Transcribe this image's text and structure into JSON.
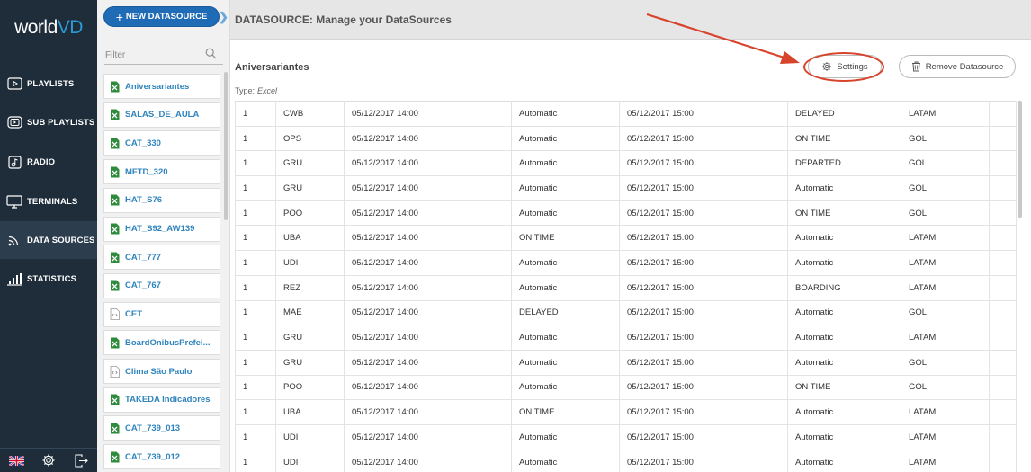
{
  "app": {
    "logo_text_1": "world",
    "logo_text_2": "VD",
    "accent_color": "#2a9ad6",
    "brand_blue": "#1f6bb5",
    "annotation_color": "#d8432b"
  },
  "nav": {
    "items": [
      {
        "label": "PLAYLISTS",
        "icon": "playlist-icon"
      },
      {
        "label": "SUB PLAYLISTS",
        "icon": "sub-playlist-icon"
      },
      {
        "label": "RADIO",
        "icon": "radio-icon"
      },
      {
        "label": "TERMINALS",
        "icon": "terminal-icon"
      },
      {
        "label": "DATA SOURCES",
        "icon": "datasource-icon"
      },
      {
        "label": "STATISTICS",
        "icon": "statistics-icon"
      }
    ],
    "active": "DATA SOURCES",
    "bottom_icons": [
      "uk-flag-icon",
      "gear-icon",
      "logout-icon"
    ]
  },
  "list": {
    "new_button": "NEW DATASOURCE",
    "filter_placeholder": "Filter",
    "items": [
      {
        "name": "Aniversariantes",
        "type": "excel"
      },
      {
        "name": "SALAS_DE_AULA",
        "type": "excel"
      },
      {
        "name": "CAT_330",
        "type": "excel"
      },
      {
        "name": "MFTD_320",
        "type": "excel"
      },
      {
        "name": "HAT_S76",
        "type": "excel"
      },
      {
        "name": "HAT_S92_AW139",
        "type": "excel"
      },
      {
        "name": "CAT_777",
        "type": "excel"
      },
      {
        "name": "CAT_767",
        "type": "excel"
      },
      {
        "name": "CET",
        "type": "web"
      },
      {
        "name": "BoardOnibusPrefei...",
        "type": "excel"
      },
      {
        "name": "Clima São Paulo",
        "type": "web"
      },
      {
        "name": "TAKEDA Indicadores",
        "type": "excel"
      },
      {
        "name": "CAT_739_013",
        "type": "excel"
      },
      {
        "name": "CAT_739_012",
        "type": "excel"
      }
    ]
  },
  "header": {
    "title": "DATASOURCE: Manage your DataSources"
  },
  "detail": {
    "name": "Aniversariantes",
    "type_label": "Type:",
    "type_value": "Excel",
    "settings_button": "Settings",
    "remove_button": "Remove Datasource"
  },
  "table": {
    "rows": [
      [
        "1",
        "CWB",
        "05/12/2017 14:00",
        "Automatic",
        "05/12/2017 15:00",
        "DELAYED",
        "LATAM",
        ""
      ],
      [
        "1",
        "OPS",
        "05/12/2017 14:00",
        "Automatic",
        "05/12/2017 15:00",
        "ON TIME",
        "GOL",
        ""
      ],
      [
        "1",
        "GRU",
        "05/12/2017 14:00",
        "Automatic",
        "05/12/2017 15:00",
        "DEPARTED",
        "GOL",
        ""
      ],
      [
        "1",
        "GRU",
        "05/12/2017 14:00",
        "Automatic",
        "05/12/2017 15:00",
        "Automatic",
        "GOL",
        ""
      ],
      [
        "1",
        "POO",
        "05/12/2017 14:00",
        "Automatic",
        "05/12/2017 15:00",
        "ON TIME",
        "GOL",
        ""
      ],
      [
        "1",
        "UBA",
        "05/12/2017 14:00",
        "ON TIME",
        "05/12/2017 15:00",
        "Automatic",
        "LATAM",
        ""
      ],
      [
        "1",
        "UDI",
        "05/12/2017 14:00",
        "Automatic",
        "05/12/2017 15:00",
        "Automatic",
        "LATAM",
        ""
      ],
      [
        "1",
        "REZ",
        "05/12/2017 14:00",
        "Automatic",
        "05/12/2017 15:00",
        "BOARDING",
        "LATAM",
        ""
      ],
      [
        "1",
        "MAE",
        "05/12/2017 14:00",
        "DELAYED",
        "05/12/2017 15:00",
        "Automatic",
        "GOL",
        ""
      ],
      [
        "1",
        "GRU",
        "05/12/2017 14:00",
        "Automatic",
        "05/12/2017 15:00",
        "Automatic",
        "LATAM",
        ""
      ],
      [
        "1",
        "GRU",
        "05/12/2017 14:00",
        "Automatic",
        "05/12/2017 15:00",
        "Automatic",
        "GOL",
        ""
      ],
      [
        "1",
        "POO",
        "05/12/2017 14:00",
        "Automatic",
        "05/12/2017 15:00",
        "ON TIME",
        "GOL",
        ""
      ],
      [
        "1",
        "UBA",
        "05/12/2017 14:00",
        "ON TIME",
        "05/12/2017 15:00",
        "Automatic",
        "LATAM",
        ""
      ],
      [
        "1",
        "UDI",
        "05/12/2017 14:00",
        "Automatic",
        "05/12/2017 15:00",
        "Automatic",
        "LATAM",
        ""
      ],
      [
        "1",
        "UDI",
        "05/12/2017 14:00",
        "Automatic",
        "05/12/2017 15:00",
        "Automatic",
        "LATAM",
        ""
      ]
    ]
  }
}
